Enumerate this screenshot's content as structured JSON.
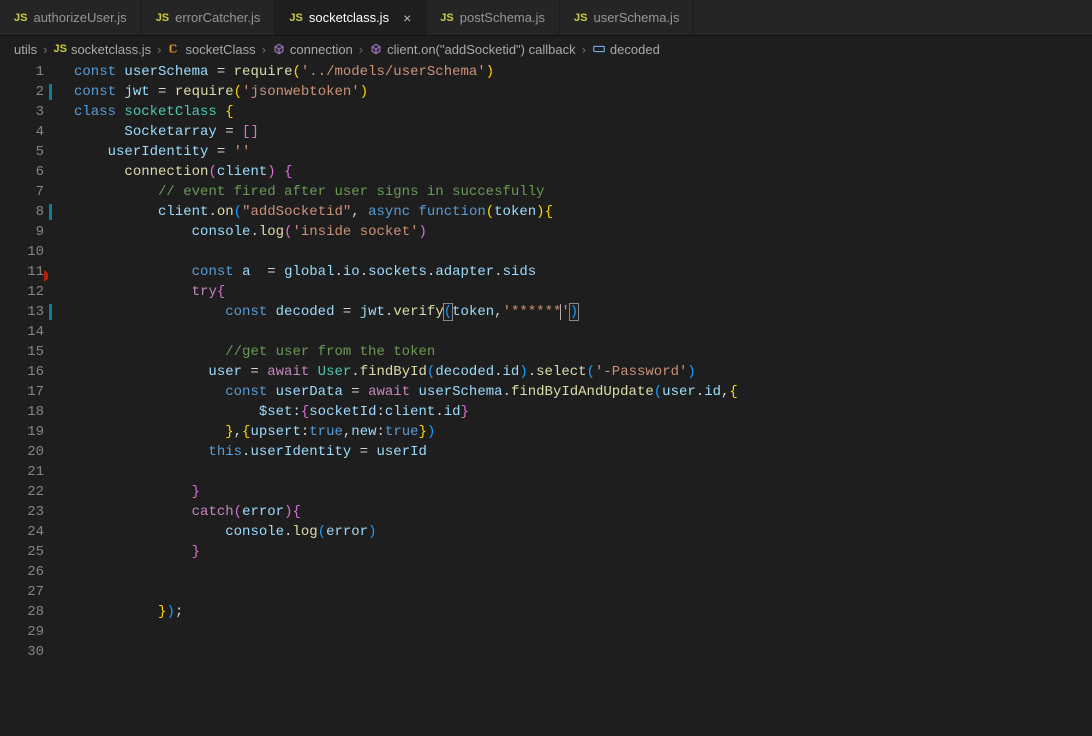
{
  "tabs": [
    {
      "label": "authorizeUser.js",
      "active": false
    },
    {
      "label": "errorCatcher.js",
      "active": false
    },
    {
      "label": "socketclass.js",
      "active": true
    },
    {
      "label": "postSchema.js",
      "active": false
    },
    {
      "label": "userSchema.js",
      "active": false
    }
  ],
  "breadcrumb": {
    "parts": [
      "utils",
      "socketclass.js",
      "socketClass",
      "connection",
      "client.on(\"addSocketid\") callback",
      "decoded"
    ]
  },
  "code": {
    "lines": [
      {
        "n": 1,
        "mod": false,
        "tokens": [
          [
            "kw",
            "const "
          ],
          [
            "var",
            "userSchema"
          ],
          [
            "plain",
            " = "
          ],
          [
            "fn",
            "require"
          ],
          [
            "br1",
            "("
          ],
          [
            "str",
            "'../models/userSchema'"
          ],
          [
            "br1",
            ")"
          ]
        ]
      },
      {
        "n": 2,
        "mod": true,
        "tokens": [
          [
            "kw",
            "const "
          ],
          [
            "var",
            "jwt"
          ],
          [
            "plain",
            " = "
          ],
          [
            "fn",
            "require"
          ],
          [
            "br1",
            "("
          ],
          [
            "str",
            "'jsonwebtoken'"
          ],
          [
            "br1",
            ")"
          ]
        ]
      },
      {
        "n": 3,
        "mod": false,
        "tokens": [
          [
            "kw",
            "class "
          ],
          [
            "cls",
            "socketClass"
          ],
          [
            "plain",
            " "
          ],
          [
            "br1",
            "{"
          ]
        ]
      },
      {
        "n": 4,
        "mod": false,
        "indent": 1,
        "tokens": [
          [
            "var",
            "  Socketarray"
          ],
          [
            "plain",
            " = "
          ],
          [
            "br2",
            "["
          ],
          [
            "br2",
            "]"
          ]
        ]
      },
      {
        "n": 5,
        "mod": false,
        "indent": 1,
        "tokens": [
          [
            "var",
            "userIdentity"
          ],
          [
            "plain",
            " = "
          ],
          [
            "str",
            "''"
          ]
        ]
      },
      {
        "n": 6,
        "mod": false,
        "indent": 1,
        "tokens": [
          [
            "plain",
            "  "
          ],
          [
            "fn",
            "connection"
          ],
          [
            "br2",
            "("
          ],
          [
            "var",
            "client"
          ],
          [
            "br2",
            ")"
          ],
          [
            "plain",
            " "
          ],
          [
            "br2",
            "{"
          ]
        ]
      },
      {
        "n": 7,
        "mod": false,
        "indent": 2,
        "tokens": [
          [
            "plain",
            "  "
          ],
          [
            "cmt",
            "// event fired after user signs in succesfully"
          ]
        ]
      },
      {
        "n": 8,
        "mod": true,
        "indent": 2,
        "tokens": [
          [
            "plain",
            "  "
          ],
          [
            "var",
            "client"
          ],
          [
            "plain",
            "."
          ],
          [
            "fn",
            "on"
          ],
          [
            "br3",
            "("
          ],
          [
            "str",
            "\"addSocketid\""
          ],
          [
            "plain",
            ", "
          ],
          [
            "kw",
            "async "
          ],
          [
            "kw",
            "function"
          ],
          [
            "br1",
            "("
          ],
          [
            "var",
            "token"
          ],
          [
            "br1",
            ")"
          ],
          [
            "br1",
            "{"
          ]
        ]
      },
      {
        "n": 9,
        "mod": false,
        "indent": 3,
        "tokens": [
          [
            "plain",
            "  "
          ],
          [
            "var",
            "console"
          ],
          [
            "plain",
            "."
          ],
          [
            "fn",
            "log"
          ],
          [
            "br2",
            "("
          ],
          [
            "str",
            "'inside socket'"
          ],
          [
            "br2",
            ")"
          ]
        ]
      },
      {
        "n": 10,
        "mod": false,
        "indent": 3,
        "tokens": []
      },
      {
        "n": 11,
        "mod": false,
        "modRed": true,
        "indent": 3,
        "tokens": [
          [
            "plain",
            "  "
          ],
          [
            "kw",
            "const "
          ],
          [
            "var",
            "a"
          ],
          [
            "plain",
            "  = "
          ],
          [
            "var",
            "global"
          ],
          [
            "plain",
            "."
          ],
          [
            "var",
            "io"
          ],
          [
            "plain",
            "."
          ],
          [
            "var",
            "sockets"
          ],
          [
            "plain",
            "."
          ],
          [
            "var",
            "adapter"
          ],
          [
            "plain",
            "."
          ],
          [
            "var",
            "sids"
          ]
        ]
      },
      {
        "n": 12,
        "mod": false,
        "indent": 3,
        "tokens": [
          [
            "plain",
            "  "
          ],
          [
            "kw2",
            "try"
          ],
          [
            "br2",
            "{"
          ]
        ]
      },
      {
        "n": 13,
        "mod": true,
        "indent": 4,
        "tokens": [
          [
            "plain",
            "  "
          ],
          [
            "kw",
            "const "
          ],
          [
            "var",
            "decoded"
          ],
          [
            "plain",
            " = "
          ],
          [
            "var",
            "jwt"
          ],
          [
            "plain",
            "."
          ],
          [
            "fn",
            "verify"
          ],
          [
            "br3 hl-bracket",
            "("
          ],
          [
            "var",
            "token"
          ],
          [
            "plain",
            ","
          ],
          [
            "str",
            "'******"
          ],
          [
            "cursor",
            ""
          ],
          [
            "str",
            "'"
          ],
          [
            "br3 hl-bracket",
            ")"
          ]
        ]
      },
      {
        "n": 14,
        "mod": false,
        "indent": 4,
        "tokens": []
      },
      {
        "n": 15,
        "mod": false,
        "indent": 4,
        "tokens": [
          [
            "plain",
            "  "
          ],
          [
            "cmt",
            "//get user from the token"
          ]
        ]
      },
      {
        "n": 16,
        "mod": false,
        "indent": 4,
        "tokens": [
          [
            "var",
            "user"
          ],
          [
            "plain",
            " = "
          ],
          [
            "kw2",
            "await "
          ],
          [
            "cls",
            "User"
          ],
          [
            "plain",
            "."
          ],
          [
            "fn",
            "findById"
          ],
          [
            "br3",
            "("
          ],
          [
            "var",
            "decoded"
          ],
          [
            "plain",
            "."
          ],
          [
            "var",
            "id"
          ],
          [
            "br3",
            ")"
          ],
          [
            "plain",
            "."
          ],
          [
            "fn",
            "select"
          ],
          [
            "br3",
            "("
          ],
          [
            "str",
            "'-Password'"
          ],
          [
            "br3",
            ")"
          ]
        ]
      },
      {
        "n": 17,
        "mod": false,
        "indent": 4,
        "tokens": [
          [
            "plain",
            "  "
          ],
          [
            "kw",
            "const "
          ],
          [
            "var",
            "userData"
          ],
          [
            "plain",
            " = "
          ],
          [
            "kw2",
            "await "
          ],
          [
            "var",
            "userSchema"
          ],
          [
            "plain",
            "."
          ],
          [
            "fn",
            "findByIdAndUpdate"
          ],
          [
            "br3",
            "("
          ],
          [
            "var",
            "user"
          ],
          [
            "plain",
            "."
          ],
          [
            "var",
            "id"
          ],
          [
            "plain",
            ","
          ],
          [
            "br1",
            "{"
          ]
        ]
      },
      {
        "n": 18,
        "mod": false,
        "indent": 5,
        "tokens": [
          [
            "plain",
            "  "
          ],
          [
            "var",
            "$set"
          ],
          [
            "plain",
            ":"
          ],
          [
            "br2",
            "{"
          ],
          [
            "var",
            "socketId"
          ],
          [
            "plain",
            ":"
          ],
          [
            "var",
            "client"
          ],
          [
            "plain",
            "."
          ],
          [
            "var",
            "id"
          ],
          [
            "br2",
            "}"
          ]
        ]
      },
      {
        "n": 19,
        "mod": false,
        "indent": 4,
        "tokens": [
          [
            "plain",
            "  "
          ],
          [
            "br1",
            "}"
          ],
          [
            "plain",
            ","
          ],
          [
            "br1",
            "{"
          ],
          [
            "var",
            "upsert"
          ],
          [
            "plain",
            ":"
          ],
          [
            "kw",
            "true"
          ],
          [
            "plain",
            ","
          ],
          [
            "var",
            "new"
          ],
          [
            "plain",
            ":"
          ],
          [
            "kw",
            "true"
          ],
          [
            "br1",
            "}"
          ],
          [
            "br3",
            ")"
          ]
        ]
      },
      {
        "n": 20,
        "mod": false,
        "indent": 4,
        "tokens": [
          [
            "kw",
            "this"
          ],
          [
            "plain",
            "."
          ],
          [
            "var",
            "userIdentity"
          ],
          [
            "plain",
            " = "
          ],
          [
            "var",
            "userId"
          ]
        ]
      },
      {
        "n": 21,
        "mod": false,
        "indent": 4,
        "tokens": []
      },
      {
        "n": 22,
        "mod": false,
        "indent": 3,
        "tokens": [
          [
            "plain",
            "  "
          ],
          [
            "br2",
            "}"
          ]
        ]
      },
      {
        "n": 23,
        "mod": false,
        "indent": 3,
        "tokens": [
          [
            "plain",
            "  "
          ],
          [
            "kw2",
            "catch"
          ],
          [
            "br2",
            "("
          ],
          [
            "var",
            "error"
          ],
          [
            "br2",
            ")"
          ],
          [
            "br2",
            "{"
          ]
        ]
      },
      {
        "n": 24,
        "mod": false,
        "indent": 4,
        "tokens": [
          [
            "plain",
            "  "
          ],
          [
            "var",
            "console"
          ],
          [
            "plain",
            "."
          ],
          [
            "fn",
            "log"
          ],
          [
            "br3",
            "("
          ],
          [
            "var",
            "error"
          ],
          [
            "br3",
            ")"
          ]
        ]
      },
      {
        "n": 25,
        "mod": false,
        "indent": 3,
        "tokens": [
          [
            "plain",
            "  "
          ],
          [
            "br2",
            "}"
          ]
        ]
      },
      {
        "n": 26,
        "mod": false,
        "indent": 3,
        "tokens": []
      },
      {
        "n": 27,
        "mod": false,
        "indent": 3,
        "tokens": []
      },
      {
        "n": 28,
        "mod": false,
        "indent": 2,
        "tokens": [
          [
            "plain",
            "  "
          ],
          [
            "br1",
            "}"
          ],
          [
            "br3",
            ")"
          ],
          [
            "plain",
            ";"
          ]
        ]
      },
      {
        "n": 29,
        "mod": false,
        "tokens": []
      },
      {
        "n": 30,
        "mod": false,
        "tokens": []
      }
    ],
    "indentUnit": "    "
  }
}
